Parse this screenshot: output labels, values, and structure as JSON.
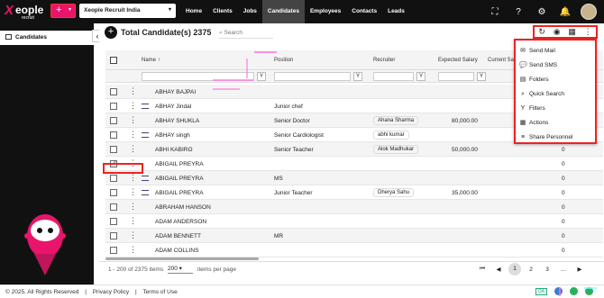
{
  "brand": {
    "name": "eople",
    "sub": "recruit",
    "accent": "#e8156b"
  },
  "header": {
    "add_label": "+",
    "company": "Xeople Recruit India",
    "nav": [
      "Home",
      "Clients",
      "Jobs",
      "Candidates",
      "Employees",
      "Contacts",
      "Leads"
    ],
    "active": "Candidates"
  },
  "sidebar": {
    "item": "Candidates"
  },
  "main": {
    "title": "Total Candidate(s) 2375",
    "search_placeholder": "Search"
  },
  "table": {
    "columns": [
      "Name",
      "Position",
      "Recruiter",
      "Expected Salary",
      "Current Sal"
    ],
    "rows": [
      {
        "name": "ABHAY BAJPAI",
        "position": "",
        "recruiter": "",
        "salary": "",
        "num": ""
      },
      {
        "name": "ABHAY Jindal",
        "position": "Junior chef",
        "recruiter": "",
        "salary": "",
        "num": ""
      },
      {
        "name": "ABHAY SHUKLA",
        "position": "Senior Doctor",
        "recruiter": "Ahana Sharma",
        "salary": "80,000.00",
        "num": ""
      },
      {
        "name": "ABHAY singh",
        "position": "Senior Cardiologist",
        "recruiter": "abhi kumar",
        "salary": "",
        "num": ""
      },
      {
        "name": "ABHI KABIRO",
        "position": "Senior Teacher",
        "recruiter": "Alok Madhukar",
        "salary": "50,000.00",
        "num": "0"
      },
      {
        "name": "ABIGAIL PREYRA",
        "position": "",
        "recruiter": "",
        "salary": "",
        "num": "0"
      },
      {
        "name": "ABIGAIL PREYRA",
        "position": "MS",
        "recruiter": "",
        "salary": "",
        "num": "0"
      },
      {
        "name": "ABIGAIL PREYRA",
        "position": "Junior Teacher",
        "recruiter": "Dherya Sahu",
        "salary": "35,000.00",
        "num": "0"
      },
      {
        "name": "ABRAHAM HANSON",
        "position": "",
        "recruiter": "",
        "salary": "",
        "num": "0"
      },
      {
        "name": "ADAM ANDERSON",
        "position": "",
        "recruiter": "",
        "salary": "",
        "num": "0"
      },
      {
        "name": "ADAM BENNETT",
        "position": "MR",
        "recruiter": "",
        "salary": "",
        "num": "0"
      },
      {
        "name": "ADAM COLLINS",
        "position": "",
        "recruiter": "",
        "salary": "",
        "num": "0"
      }
    ]
  },
  "menu": [
    "Send Mail",
    "Send SMS",
    "Folders",
    "Quick Search",
    "Filters",
    "Actions",
    "Share Personnel"
  ],
  "pagination": {
    "info": "1 - 200 of 2375 items",
    "size": "200",
    "per": "items per page",
    "pages": [
      "1",
      "2",
      "3"
    ]
  },
  "footer": {
    "copy": "© 2025. All Rights Reserved",
    "privacy": "Privacy Policy",
    "terms": "Terms of Use",
    "qa": "QA"
  }
}
